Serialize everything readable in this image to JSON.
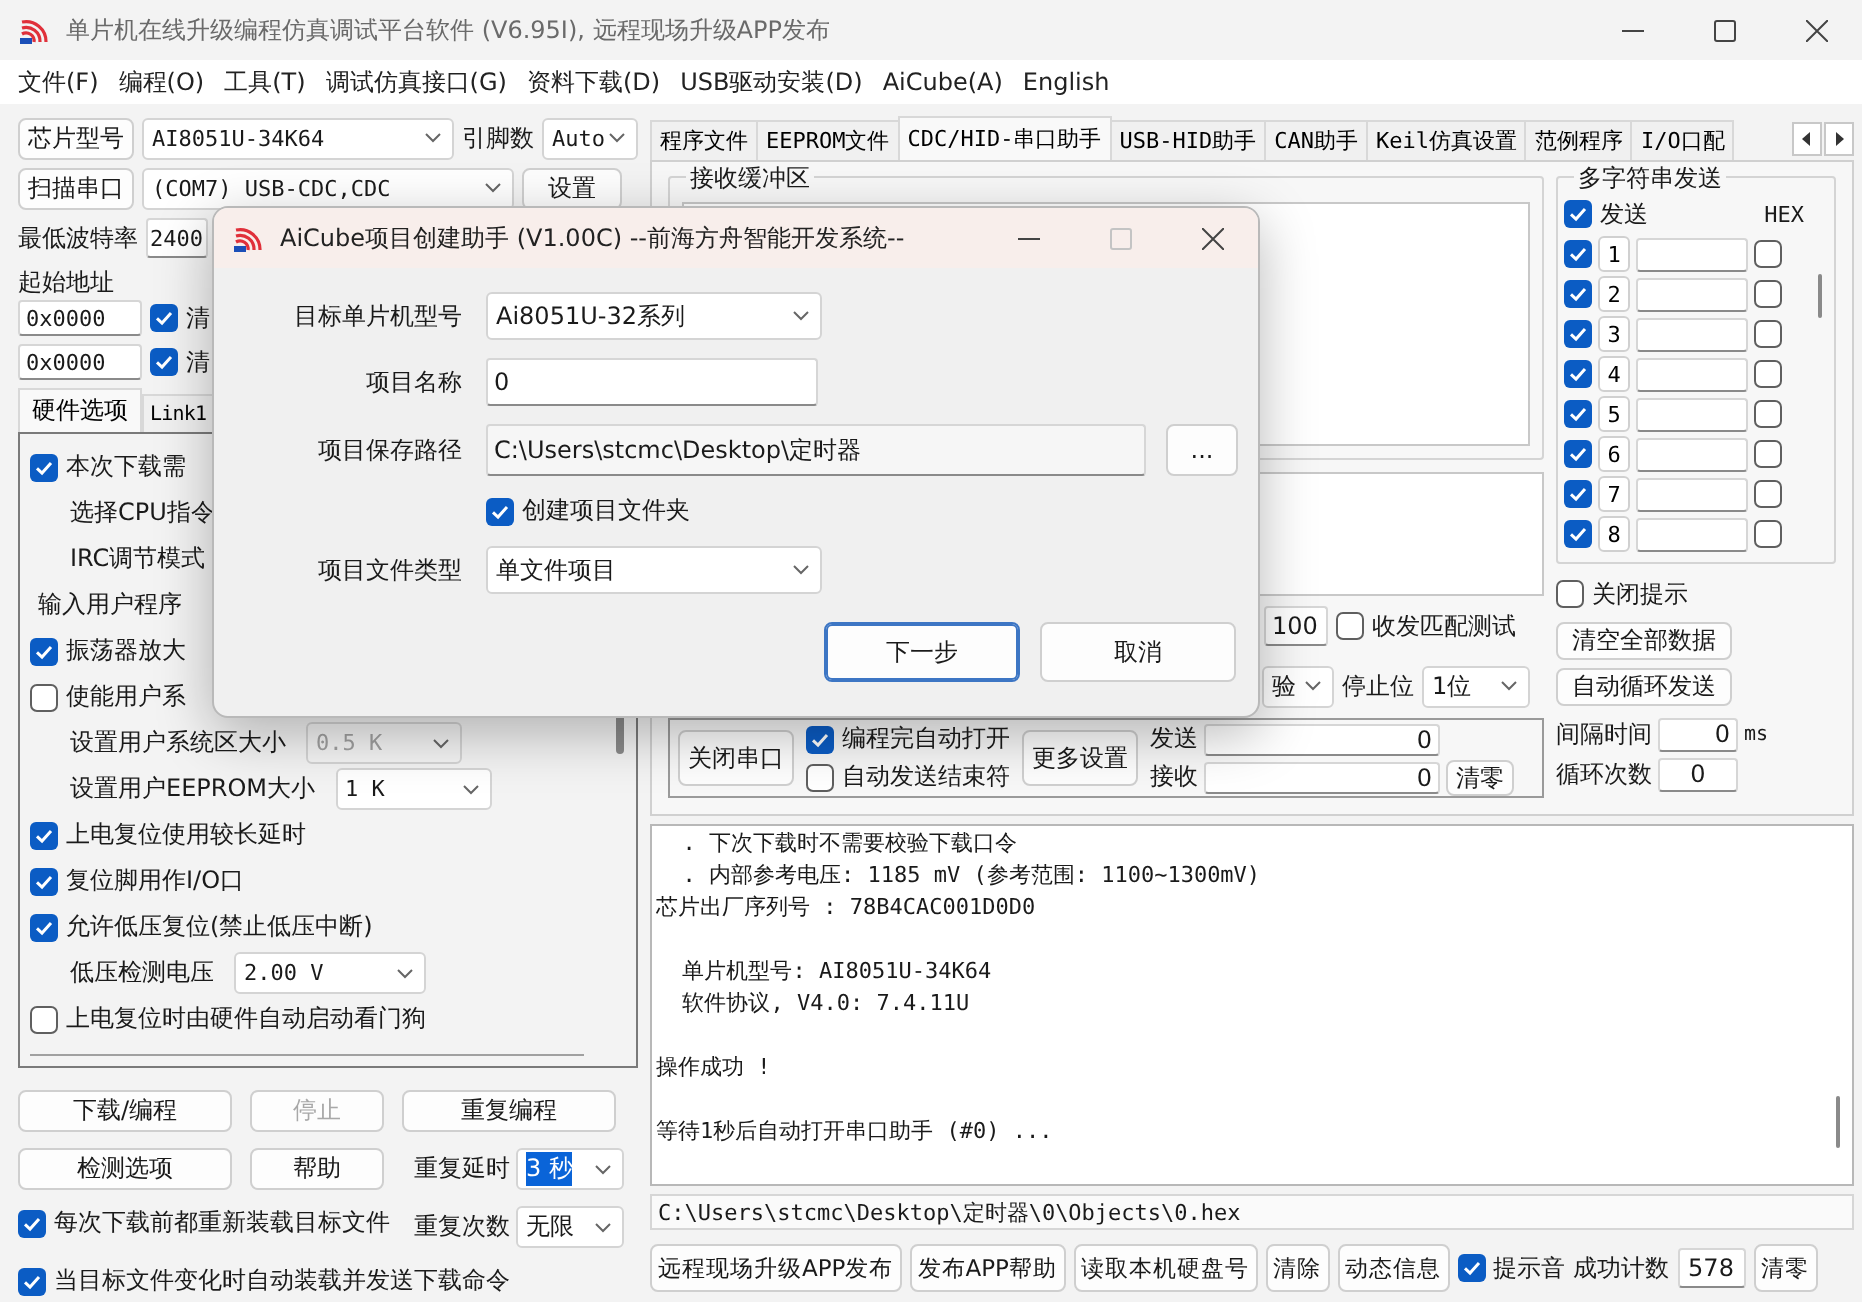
{
  "window": {
    "title": "单片机在线升级编程仿真调试平台软件 (V6.95I), 远程现场升级APP发布"
  },
  "menu": [
    "文件(F)",
    "编程(O)",
    "工具(T)",
    "调试仿真接口(G)",
    "资料下载(D)",
    "USB驱动安装(D)",
    "AiCube(A)",
    "English"
  ],
  "chip": {
    "button": "芯片型号",
    "model": "AI8051U-34K64",
    "pins_label": "引脚数",
    "pins": "Auto"
  },
  "port": {
    "button": "扫描串口",
    "value": "(COM7) USB-CDC,CDC",
    "settings": "设置"
  },
  "baud": {
    "label": "最低波特率",
    "value": "2400"
  },
  "address": {
    "label": "起始地址",
    "rows": [
      {
        "value": "0x0000",
        "checked": true,
        "label": "清"
      },
      {
        "value": "0x0000",
        "checked": true,
        "label": "清"
      }
    ]
  },
  "left_tabs": [
    {
      "label": "硬件选项",
      "selected": true
    },
    {
      "label": "Link1",
      "selected": false
    }
  ],
  "options": [
    {
      "kind": "check",
      "label": "本次下载需",
      "checked": true
    },
    {
      "kind": "text",
      "label": "选择CPU指令"
    },
    {
      "kind": "text",
      "label": "IRC调节模式"
    },
    {
      "kind": "note",
      "label": "输入用户程序"
    },
    {
      "kind": "check",
      "label": "振荡器放大",
      "checked": true
    },
    {
      "kind": "check",
      "label": "使能用户系",
      "checked": false
    },
    {
      "kind": "select",
      "label": "设置用户系统区大小",
      "value": "0.5 K",
      "disabled": true
    },
    {
      "kind": "select",
      "label": "设置用户EEPROM大小",
      "value": "1 K",
      "disabled": false
    },
    {
      "kind": "check",
      "label": "上电复位使用较长延时",
      "checked": true
    },
    {
      "kind": "check",
      "label": "复位脚用作I/O口",
      "checked": true
    },
    {
      "kind": "check",
      "label": "允许低压复位(禁止低压中断)",
      "checked": true
    },
    {
      "kind": "select",
      "label": "低压检测电压",
      "value": "2.00 V",
      "disabled": false
    },
    {
      "kind": "check",
      "label": "上电复位时由硬件自动启动看门狗",
      "checked": false
    }
  ],
  "actions": [
    {
      "label": "下载/编程",
      "disabled": false
    },
    {
      "label": "停止",
      "disabled": true
    },
    {
      "label": "重复编程",
      "disabled": false
    },
    {
      "label": "检测选项",
      "disabled": false
    },
    {
      "label": "帮助",
      "disabled": false
    }
  ],
  "repeat": [
    {
      "label": "重复延时",
      "value": "3 秒",
      "selected": true
    },
    {
      "label": "重复次数",
      "value": "无限",
      "selected": false
    }
  ],
  "reload": [
    {
      "label": "每次下载前都重新装载目标文件",
      "checked": true
    },
    {
      "label": "当目标文件变化时自动装载并发送下载命令",
      "checked": true
    }
  ],
  "tabs": [
    {
      "label": "程序文件",
      "selected": false
    },
    {
      "label": "EEPROM文件",
      "selected": false
    },
    {
      "label": "CDC/HID-串口助手",
      "selected": true
    },
    {
      "label": "USB-HID助手",
      "selected": false
    },
    {
      "label": "CAN助手",
      "selected": false
    },
    {
      "label": "Keil仿真设置",
      "selected": false
    },
    {
      "label": "范例程序",
      "selected": false
    },
    {
      "label": "I/O口配",
      "selected": false
    }
  ],
  "serial": {
    "receive_title": "接收缓冲区",
    "timeout": "100",
    "match_test": {
      "label": "收发匹配测试",
      "checked": false
    },
    "parity": "验",
    "stop_label": "停止位",
    "stop": "1位",
    "close_button": "关闭串口",
    "auto_checks": [
      {
        "label": "编程完自动打开",
        "checked": true
      },
      {
        "label": "自动发送结束符",
        "checked": false
      }
    ],
    "more_button": "更多设置",
    "counters": [
      {
        "label": "发送",
        "value": "0"
      },
      {
        "label": "接收",
        "value": "0"
      }
    ],
    "clear_button": "清零"
  },
  "multi_send": {
    "title": "多字符串发送",
    "send": {
      "label": "发送",
      "checked": true
    },
    "hex_label": "HEX",
    "rows": [
      {
        "number": "1",
        "checked": true,
        "hex": false
      },
      {
        "number": "2",
        "checked": true,
        "hex": false
      },
      {
        "number": "3",
        "checked": true,
        "hex": false
      },
      {
        "number": "4",
        "checked": true,
        "hex": false
      },
      {
        "number": "5",
        "checked": true,
        "hex": false
      },
      {
        "number": "6",
        "checked": true,
        "hex": false
      },
      {
        "number": "7",
        "checked": true,
        "hex": false
      },
      {
        "number": "8",
        "checked": true,
        "hex": false
      }
    ],
    "close_tip": {
      "label": "关闭提示",
      "checked": false
    },
    "buttons": [
      "清空全部数据",
      "自动循环发送"
    ],
    "interval": {
      "label": "间隔时间",
      "value": "0",
      "unit": "ms"
    },
    "loops": {
      "label": "循环次数",
      "value": "0"
    }
  },
  "log": {
    "blocks": [
      [
        "  . 下次下载时不需要校验下载口令",
        "  . 内部参考电压: 1185 mV (参考范围: 1100~1300mV)",
        "芯片出厂序列号 : 78B4CAC001D0D0"
      ],
      [
        "  单片机型号: AI8051U-34K64",
        "  软件协议, V4.0: 7.4.11U"
      ],
      [
        "操作成功 !"
      ],
      [
        "等待1秒后自动打开串口助手 (#0) ..."
      ]
    ]
  },
  "file_path": "C:\\Users\\stcmc\\Desktop\\定时器\\0\\Objects\\0.hex",
  "bottom": {
    "buttons": [
      "远程现场升级APP发布",
      "发布APP帮助",
      "读取本机硬盘号",
      "清除",
      "动态信息"
    ],
    "beep": {
      "label": "提示音",
      "checked": true
    },
    "count_label": "成功计数",
    "count": "578",
    "clear": "清零"
  },
  "dialog": {
    "title": "AiCube项目创建助手 (V1.00C) --前海方舟智能开发系统--",
    "fields": [
      {
        "kind": "select",
        "label": "目标单片机型号",
        "value": "Ai8051U-32系列"
      },
      {
        "kind": "input",
        "label": "项目名称",
        "value": "0"
      },
      {
        "kind": "path",
        "label": "项目保存路径",
        "value": "C:\\Users\\stcmc\\Desktop\\定时器",
        "button": "..."
      },
      {
        "kind": "check",
        "label": "创建项目文件夹",
        "checked": true
      },
      {
        "kind": "select",
        "label": "项目文件类型",
        "value": "单文件项目"
      }
    ],
    "buttons": [
      {
        "label": "下一步",
        "default": true
      },
      {
        "label": "取消",
        "default": false
      }
    ]
  }
}
